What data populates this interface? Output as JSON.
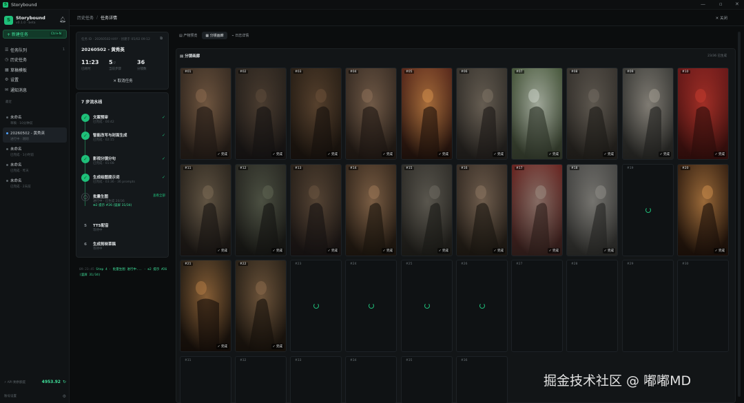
{
  "window": {
    "title": "Storybound",
    "icon_letter": "S",
    "controls": [
      "—",
      "▫",
      "✕"
    ]
  },
  "sidebar": {
    "brand_name": "Storybound",
    "brand_version": "v0.1.0 · beta",
    "new_task_label": "+ 新建任务",
    "new_task_kbd": "Ctrl+N",
    "nav": [
      {
        "icon": "☰",
        "label": "任务队列",
        "count": "1"
      },
      {
        "icon": "◷",
        "label": "历史任务",
        "count": ""
      },
      {
        "icon": "▦",
        "label": "草稿模板",
        "count": ""
      },
      {
        "icon": "⚙",
        "label": "设置",
        "count": ""
      },
      {
        "icon": "✉",
        "label": "通知消息",
        "count": ""
      }
    ],
    "section_label": "最近",
    "history": [
      {
        "title": "未命名",
        "sub": "草稿 · 10分钟前"
      },
      {
        "title": "20260502 - 黄秀英",
        "sub": "进行中 · 刚刚"
      },
      {
        "title": "未命名",
        "sub": "已完成 · 1小时前"
      },
      {
        "title": "未命名",
        "sub": "已完成 · 昨天"
      },
      {
        "title": "未命名",
        "sub": "已完成 · 2天前"
      }
    ],
    "credits_label": "⚡ API 剩余额度",
    "credits_value": "4953.92",
    "footer_label": "账号设置"
  },
  "topbar": {
    "crumb1": "历史任务",
    "separator": "/",
    "crumb2": "任务详情",
    "close": "✕ 关闭"
  },
  "summary": {
    "meta": "任务 ID · 20260502-HXY · 创建于 05/02 09:12",
    "task_name": "20260502 - 黄秀英",
    "stats": [
      {
        "value": "11:23",
        "unit": "",
        "label": "已耗时"
      },
      {
        "value": "5",
        "unit": "/7",
        "label": "当前步骤"
      },
      {
        "value": "36",
        "unit": "",
        "label": "分镜数"
      }
    ],
    "cancel_label": "✕ 取消任务"
  },
  "pipeline": {
    "title": "7 步流水线",
    "steps": [
      {
        "n": "✓",
        "state": "done",
        "title": "文案预审",
        "sub": "已完成 · 00:42"
      },
      {
        "n": "✓",
        "state": "done",
        "title": "智能改写与封面生成",
        "sub": "已完成 · 02:15"
      },
      {
        "n": "✓",
        "state": "done",
        "title": "影视分镜分句",
        "sub": "已完成 · 01:08"
      },
      {
        "n": "✓",
        "state": "done",
        "title": "生成绘图提示词",
        "sub": "已完成 · 03:36 · 36 prompts"
      },
      {
        "n": "○",
        "state": "run",
        "title": "批量生图",
        "sub": "进行中 · 已生成 20/36",
        "more": "查看全部",
        "prog": "⊕2 提示 #26 (竖屏 31/34)"
      },
      {
        "n": "5",
        "state": "pend",
        "title": "TTS配音",
        "sub": "等待中"
      },
      {
        "n": "6",
        "state": "pend",
        "title": "生成剪映草稿",
        "sub": "等待中"
      }
    ]
  },
  "log": {
    "ts": "09:23:45",
    "text": "Step 4 · 批量生图 进行中... · ⊕2 提示 #26 (竖屏 31/34)"
  },
  "tabs": [
    "▤ 产物预览",
    "▦ 分镜画廊",
    "⌁ 日志详情"
  ],
  "gallery": {
    "title": "▤ 分镜画廊",
    "count_label": "23/36 已生成",
    "done_label": "✓ 完成",
    "tiles": [
      {
        "n": "#01",
        "done": true
      },
      {
        "n": "#02",
        "done": true
      },
      {
        "n": "#03",
        "done": true
      },
      {
        "n": "#04",
        "done": true
      },
      {
        "n": "#05",
        "done": true
      },
      {
        "n": "#06",
        "done": true
      },
      {
        "n": "#07",
        "done": true
      },
      {
        "n": "#08",
        "done": true
      },
      {
        "n": "#09",
        "done": true
      },
      {
        "n": "#10",
        "done": true
      },
      {
        "n": "#11",
        "done": true
      },
      {
        "n": "#12",
        "done": true
      },
      {
        "n": "#13",
        "done": true
      },
      {
        "n": "#14",
        "done": true
      },
      {
        "n": "#15",
        "done": true
      },
      {
        "n": "#16",
        "done": true
      },
      {
        "n": "#17",
        "done": true
      },
      {
        "n": "#18",
        "done": true
      },
      {
        "n": "#19",
        "done": false,
        "spin": true
      },
      {
        "n": "#20",
        "done": true
      },
      {
        "n": "#21",
        "done": true
      },
      {
        "n": "#22",
        "done": true
      },
      {
        "n": "#23",
        "done": false,
        "spin": true
      },
      {
        "n": "#24",
        "done": false,
        "spin": true
      },
      {
        "n": "#25",
        "done": false,
        "spin": true
      },
      {
        "n": "#26",
        "done": false,
        "spin": true
      },
      {
        "n": "#27",
        "done": false
      },
      {
        "n": "#28",
        "done": false
      },
      {
        "n": "#29",
        "done": false
      },
      {
        "n": "#30",
        "done": false
      },
      {
        "n": "#31",
        "done": false
      },
      {
        "n": "#32",
        "done": false
      },
      {
        "n": "#33",
        "done": false
      },
      {
        "n": "#34",
        "done": false
      },
      {
        "n": "#35",
        "done": false
      },
      {
        "n": "#36",
        "done": false
      }
    ]
  },
  "watermark": "掘金技术社区 @ 嘟嘟MD",
  "colors": {
    "accent": "#1fbf7a",
    "bg": "#0b0d0e",
    "panel": "#14181b"
  }
}
